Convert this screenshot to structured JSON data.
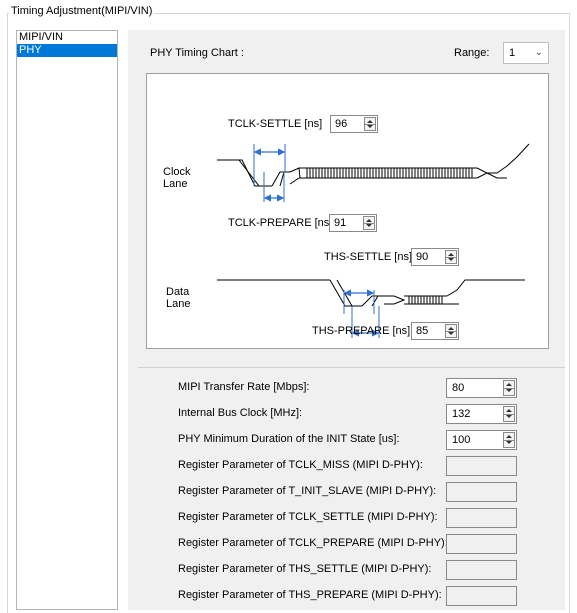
{
  "group": {
    "title": "Timing Adjustment(MIPI/VIN)"
  },
  "nav": {
    "items": [
      {
        "label": "MIPI/VIN"
      },
      {
        "label": "PHY"
      }
    ]
  },
  "chart": {
    "title": "PHY Timing Chart :",
    "range_label": "Range:",
    "range_value": "1",
    "clock_lane": [
      "Clock",
      "Lane"
    ],
    "data_lane": [
      "Data",
      "Lane"
    ],
    "tclk_settle": {
      "label": "TCLK-SETTLE [ns]",
      "value": "96"
    },
    "tclk_prepare": {
      "label": "TCLK-PREPARE [ns]",
      "value": "91"
    },
    "ths_settle": {
      "label": "THS-SETTLE [ns]",
      "value": "90"
    },
    "ths_prepare": {
      "label": "THS-PREPARE [ns]",
      "value": "85"
    }
  },
  "settings": {
    "rows": [
      {
        "label": "MIPI Transfer Rate [Mbps]:",
        "value": "80"
      },
      {
        "label": "Internal Bus Clock [MHz]:",
        "value": "132"
      },
      {
        "label": "PHY Minimum Duration of the INIT State [us]:",
        "value": "100"
      },
      {
        "label": "Register Parameter of TCLK_MISS (MIPI D-PHY):",
        "value": ""
      },
      {
        "label": "Register Parameter of T_INIT_SLAVE (MIPI D-PHY):",
        "value": ""
      },
      {
        "label": "Register Parameter of TCLK_SETTLE (MIPI D-PHY):",
        "value": ""
      },
      {
        "label": "Register Parameter of TCLK_PREPARE (MIPI D-PHY):",
        "value": ""
      },
      {
        "label": "Register Parameter of THS_SETTLE (MIPI D-PHY):",
        "value": ""
      },
      {
        "label": "Register Parameter of THS_PREPARE (MIPI D-PHY):",
        "value": ""
      }
    ]
  },
  "colors": {
    "selection": "#0078d7",
    "timing_arrow": "#2f6fd0"
  }
}
